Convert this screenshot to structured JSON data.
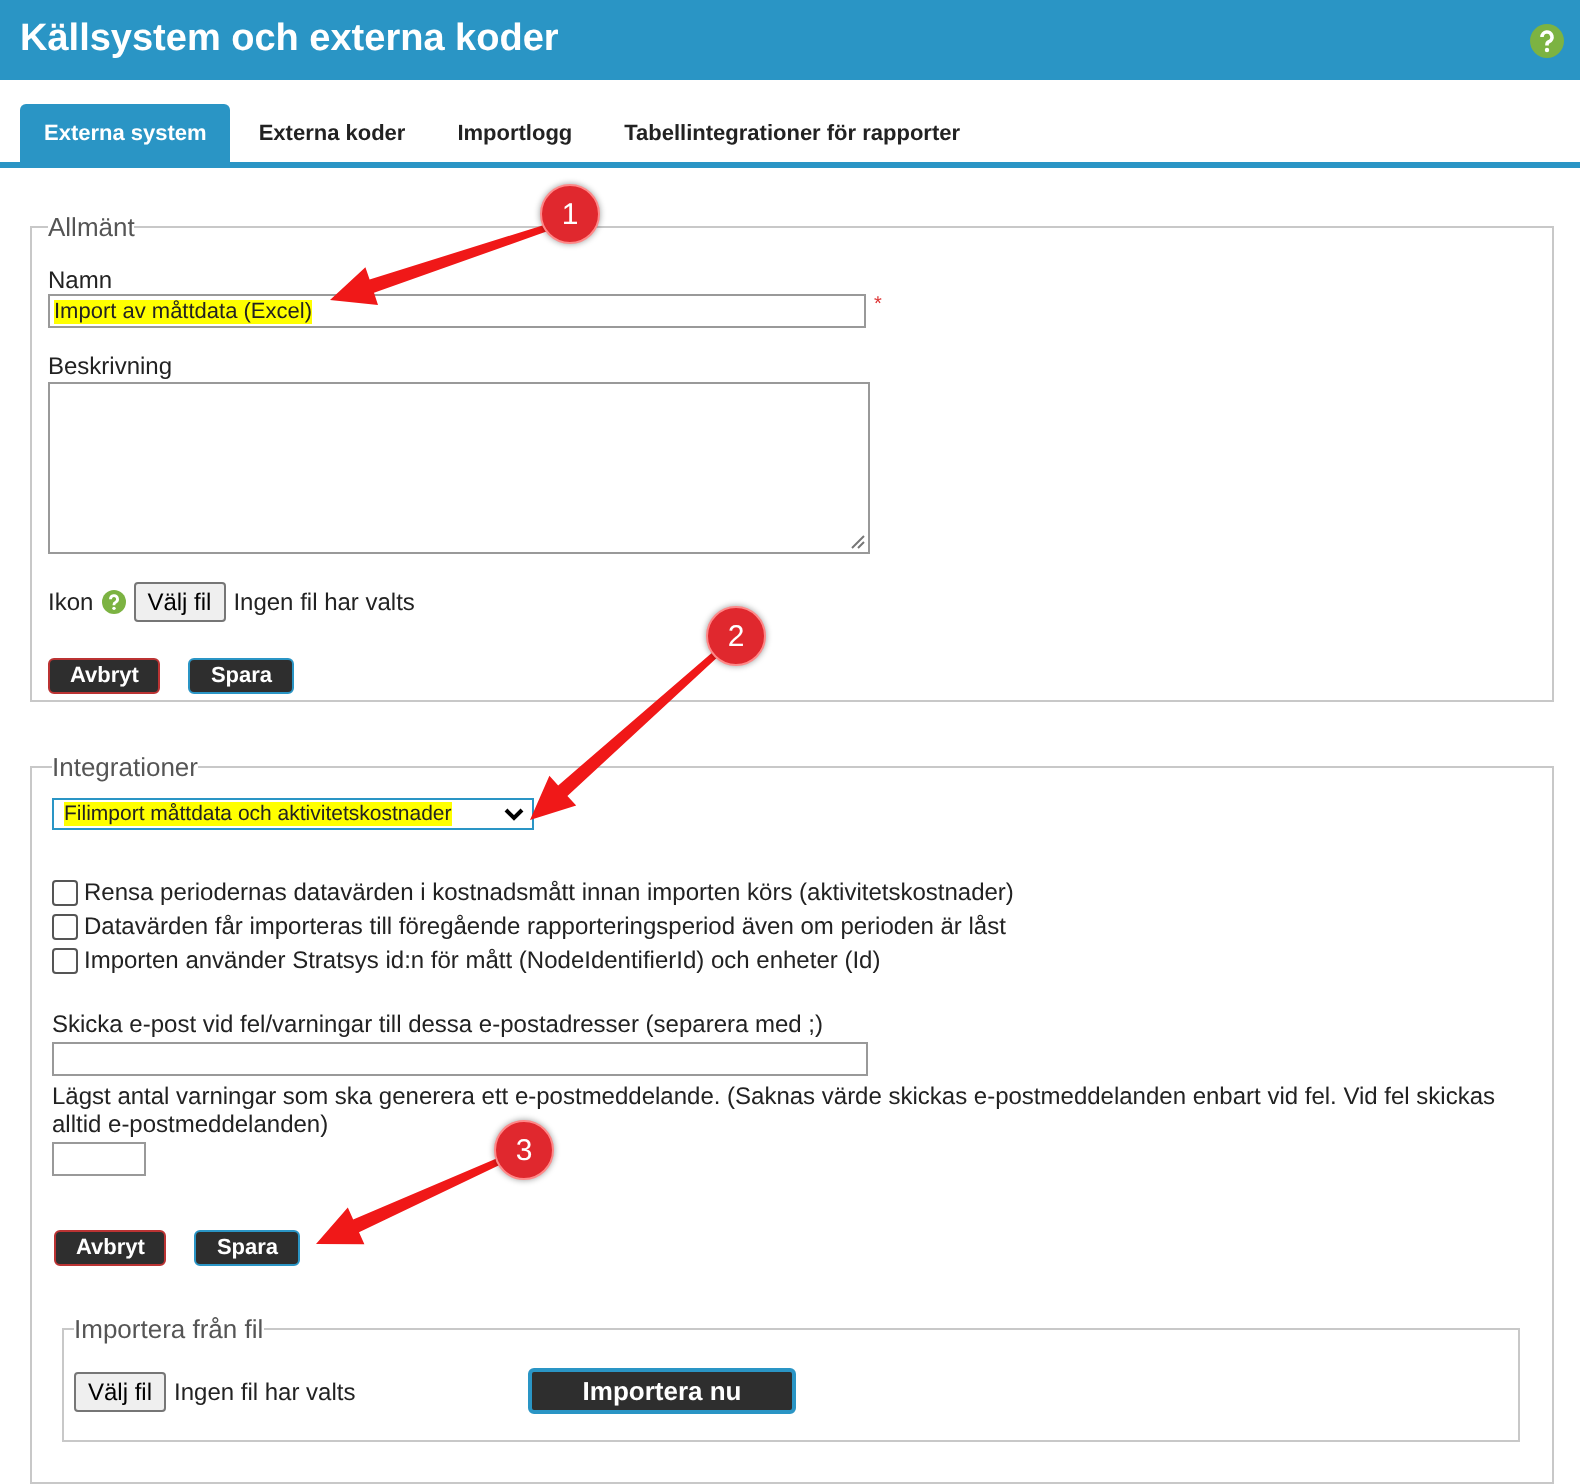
{
  "header": {
    "title": "Källsystem och externa koder"
  },
  "tabs": [
    {
      "label": "Externa system",
      "selected": true
    },
    {
      "label": "Externa koder",
      "selected": false
    },
    {
      "label": "Importlogg",
      "selected": false
    },
    {
      "label": "Tabellintegrationer för rapporter",
      "selected": false
    }
  ],
  "general": {
    "legend": "Allmänt",
    "name_label": "Namn",
    "name_value": "Import av måttdata (Excel)",
    "required_mark": "*",
    "description_label": "Beskrivning",
    "icon_label": "Ikon",
    "file_button": "Välj fil",
    "file_status": "Ingen fil har valts",
    "buttons": [
      {
        "label": "Avbryt",
        "kind": "cancel"
      },
      {
        "label": "Spara",
        "kind": "save"
      }
    ]
  },
  "integrations": {
    "legend": "Integrationer",
    "select_value": "Filimport måttdata och aktivitetskostnader",
    "options": [
      {
        "label": "Rensa periodernas datavärden i kostnadsmått innan importen körs (aktivitetskostnader)",
        "checked": false
      },
      {
        "label": "Datavärden får importeras till föregående rapporteringsperiod även om perioden är låst",
        "checked": false
      },
      {
        "label": "Importen använder Stratsys id:n för mått (NodeIdentifierId) och enheter (Id)",
        "checked": false
      }
    ],
    "email_label": "Skicka e-post vid fel/varningar till dessa e-postadresser (separera med ;)",
    "min_warnings_label": "Lägst antal varningar som ska generera ett e-postmeddelande. (Saknas värde skickas e-postmeddelanden enbart vid fel. Vid fel skickas alltid e-postmeddelanden)",
    "buttons": [
      {
        "label": "Avbryt",
        "kind": "cancel"
      },
      {
        "label": "Spara",
        "kind": "save"
      }
    ],
    "import": {
      "legend": "Importera från fil",
      "file_button": "Välj fil",
      "file_status": "Ingen fil har valts",
      "import_button": "Importera nu"
    }
  },
  "callouts": [
    {
      "number": "1"
    },
    {
      "number": "2"
    },
    {
      "number": "3"
    }
  ]
}
